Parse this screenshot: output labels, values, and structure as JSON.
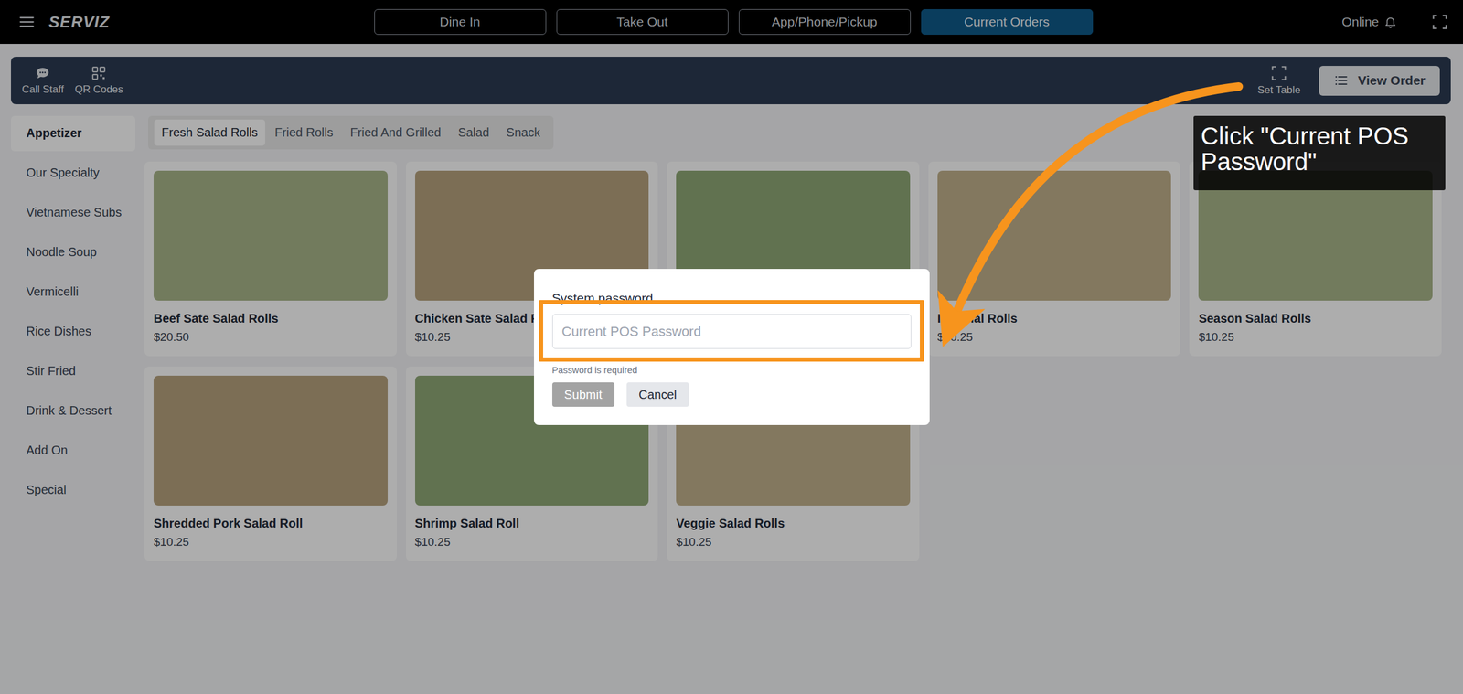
{
  "topbar": {
    "logo": "SERVIZ",
    "tabs": [
      {
        "label": "Dine In",
        "selected": false
      },
      {
        "label": "Take Out",
        "selected": false
      },
      {
        "label": "App/Phone/Pickup",
        "selected": false
      },
      {
        "label": "Current Orders",
        "selected": true
      }
    ],
    "status": "Online"
  },
  "toolbar": {
    "actions": [
      "Call Staff",
      "QR Codes"
    ],
    "set_table": "Set Table",
    "view_order": "View Order"
  },
  "categories": [
    {
      "label": "Appetizer",
      "selected": true
    },
    {
      "label": "Our Specialty",
      "selected": false
    },
    {
      "label": "Vietnamese Subs",
      "selected": false
    },
    {
      "label": "Noodle Soup",
      "selected": false
    },
    {
      "label": "Vermicelli",
      "selected": false
    },
    {
      "label": "Rice Dishes",
      "selected": false
    },
    {
      "label": "Stir Fried",
      "selected": false
    },
    {
      "label": "Drink & Dessert",
      "selected": false
    },
    {
      "label": "Add On",
      "selected": false
    },
    {
      "label": "Special",
      "selected": false
    }
  ],
  "subcategories": [
    {
      "label": "Fresh Salad Rolls",
      "selected": true
    },
    {
      "label": "Fried Rolls",
      "selected": false
    },
    {
      "label": "Fried And Grilled",
      "selected": false
    },
    {
      "label": "Salad",
      "selected": false
    },
    {
      "label": "Snack",
      "selected": false
    }
  ],
  "products": [
    {
      "name": "Beef Sate Salad Rolls",
      "price": "$20.50"
    },
    {
      "name": "Chicken Sate Salad Ro",
      "price": "$10.25"
    },
    {},
    {
      "name": "Imperial Rolls",
      "price": "$10.25"
    },
    {
      "name": "Season Salad Rolls",
      "price": "$10.25"
    },
    {
      "name": "Shredded Pork Salad Roll",
      "price": "$10.25"
    },
    {
      "name": "Shrimp Salad Roll",
      "price": "$10.25"
    },
    {
      "name": "Veggie Salad Rolls",
      "price": "$10.25"
    }
  ],
  "dialog": {
    "title": "System password",
    "placeholder": "Current POS Password",
    "hint": "Password is required",
    "buttons": [
      {
        "label": "Submit",
        "disabled": true
      },
      {
        "label": "Cancel",
        "disabled": false
      }
    ]
  },
  "callout": {
    "text": "Click \"Current POS Password\""
  }
}
